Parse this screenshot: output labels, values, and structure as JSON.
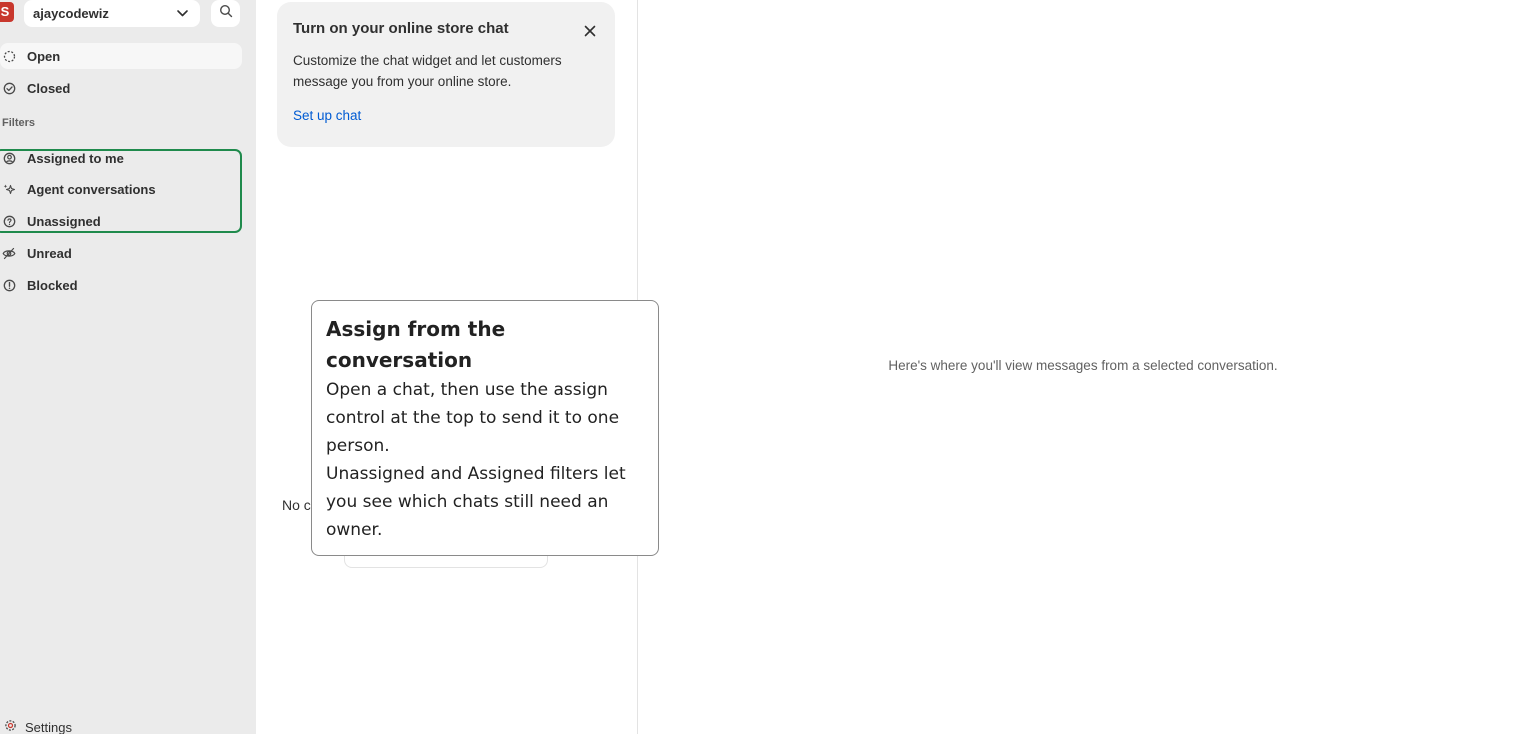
{
  "sidebar": {
    "store_logo": "S",
    "store_name": "ajaycodewiz",
    "nav": {
      "open": "Open",
      "closed": "Closed"
    },
    "filters_heading": "Filters",
    "filters": {
      "assigned_to_me": "Assigned to me",
      "agent_conversations": "Agent conversations",
      "unassigned": "Unassigned",
      "unread": "Unread",
      "blocked": "Blocked"
    },
    "settings_label": "Settings"
  },
  "promo": {
    "title": "Turn on your online store chat",
    "body": "Customize the chat widget and let customers message you from your online store.",
    "link": "Set up chat"
  },
  "conversation_list": {
    "empty_text_visible": "No c"
  },
  "message_panel": {
    "placeholder": "Here's where you'll view messages from a selected conversation."
  },
  "tooltip": {
    "title": "Assign from the conversation",
    "line1": "Open a chat, then use the assign control at the top to send it to one person.",
    "line2": "Unassigned and Assigned filters let you see which chats still need an owner."
  },
  "colors": {
    "sidebar_bg": "#ebebeb",
    "highlight": "#1f8a4c",
    "link": "#005bd3",
    "logo": "#c8372d"
  }
}
